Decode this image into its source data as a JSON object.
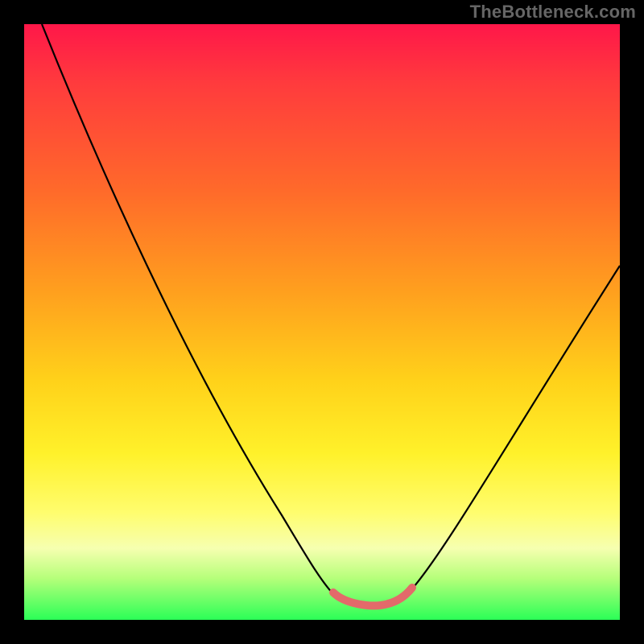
{
  "watermark": "TheBottleneck.com",
  "colors": {
    "frame": "#000000",
    "gradient_top": "#ff1749",
    "gradient_bottom": "#2bff57",
    "curve": "#000000",
    "highlight": "#e36a6a"
  },
  "chart_data": {
    "type": "line",
    "title": "",
    "xlabel": "",
    "ylabel": "",
    "xlim": [
      0,
      100
    ],
    "ylim": [
      0,
      100
    ],
    "annotations": [],
    "series": [
      {
        "name": "bottleneck-curve",
        "x": [
          3,
          10,
          20,
          30,
          40,
          47,
          51,
          55,
          58,
          60,
          65,
          70,
          80,
          90,
          100
        ],
        "y": [
          100,
          85,
          68,
          50,
          32,
          15,
          6,
          2,
          2,
          4,
          10,
          18,
          35,
          52,
          65
        ]
      },
      {
        "name": "optimal-range-highlight",
        "x": [
          47,
          51,
          55,
          58,
          60
        ],
        "y": [
          15,
          6,
          2,
          2,
          4
        ]
      }
    ]
  }
}
